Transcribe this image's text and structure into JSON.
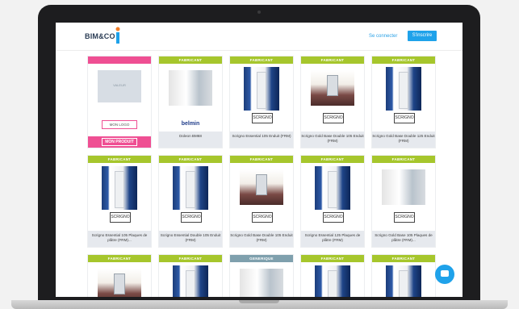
{
  "header": {
    "logo_text": "BIM&CO",
    "login_label": "Se connecter",
    "signup_label": "S'inscrire"
  },
  "cards": [
    {
      "tag": "",
      "title": "",
      "brand": "",
      "kind": "placeholder",
      "photo_label": "VALEUR",
      "my_logo": "MON LOGO",
      "my_product": "MON PRODUIT"
    },
    {
      "tag": "FABRICANT",
      "title": "Doleon BM68",
      "brand": "belmin",
      "kind": "hall"
    },
    {
      "tag": "FABRICANT",
      "title": "Scrigno Essential 105 Enduit (FRM)",
      "brand": "SCRIGNO",
      "kind": "door"
    },
    {
      "tag": "FABRICANT",
      "title": "Scrigno Gold Base Double 105 Enduit (FRM)",
      "brand": "SCRIGNO",
      "kind": "room"
    },
    {
      "tag": "FABRICANT",
      "title": "Scrigno Gold Base Double 125 Enduit (FRM)",
      "brand": "SCRIGNO",
      "kind": "door"
    },
    {
      "tag": "FABRICANT",
      "title": "Scrigno Essential 105 Plaques de plâtre (FRM)...",
      "brand": "SCRIGNO",
      "kind": "door"
    },
    {
      "tag": "FABRICANT",
      "title": "Scrigno Essential Double 105 Enduit (FRM)",
      "brand": "SCRIGNO",
      "kind": "door"
    },
    {
      "tag": "FABRICANT",
      "title": "Scrigno Gold Base Double 105 Enduit (FRM)",
      "brand": "SCRIGNO",
      "kind": "room"
    },
    {
      "tag": "FABRICANT",
      "title": "Scrigno Essential 125 Plaques de plâtre (FRM)",
      "brand": "SCRIGNO",
      "kind": "door"
    },
    {
      "tag": "FABRICANT",
      "title": "Scrigno Gold Base 105 Plaques de plâtre (FRM)...",
      "brand": "SCRIGNO",
      "kind": "hall"
    },
    {
      "tag": "FABRICANT",
      "title": "",
      "brand": "",
      "kind": "room"
    },
    {
      "tag": "FABRICANT",
      "title": "",
      "brand": "",
      "kind": "door"
    },
    {
      "tag": "GENERIQUE",
      "title": "",
      "brand": "",
      "kind": "hall"
    },
    {
      "tag": "FABRICANT",
      "title": "",
      "brand": "",
      "kind": "door"
    },
    {
      "tag": "FABRICANT",
      "title": "",
      "brand": "",
      "kind": "door"
    }
  ],
  "colors": {
    "manufacturer_tag": "#a6c62c",
    "generic_tag": "#7fa0ad",
    "promo_pink": "#ef4f93",
    "accent_blue": "#1fa2ea"
  },
  "icons": [
    "logo-mark-icon",
    "chat-icon"
  ]
}
